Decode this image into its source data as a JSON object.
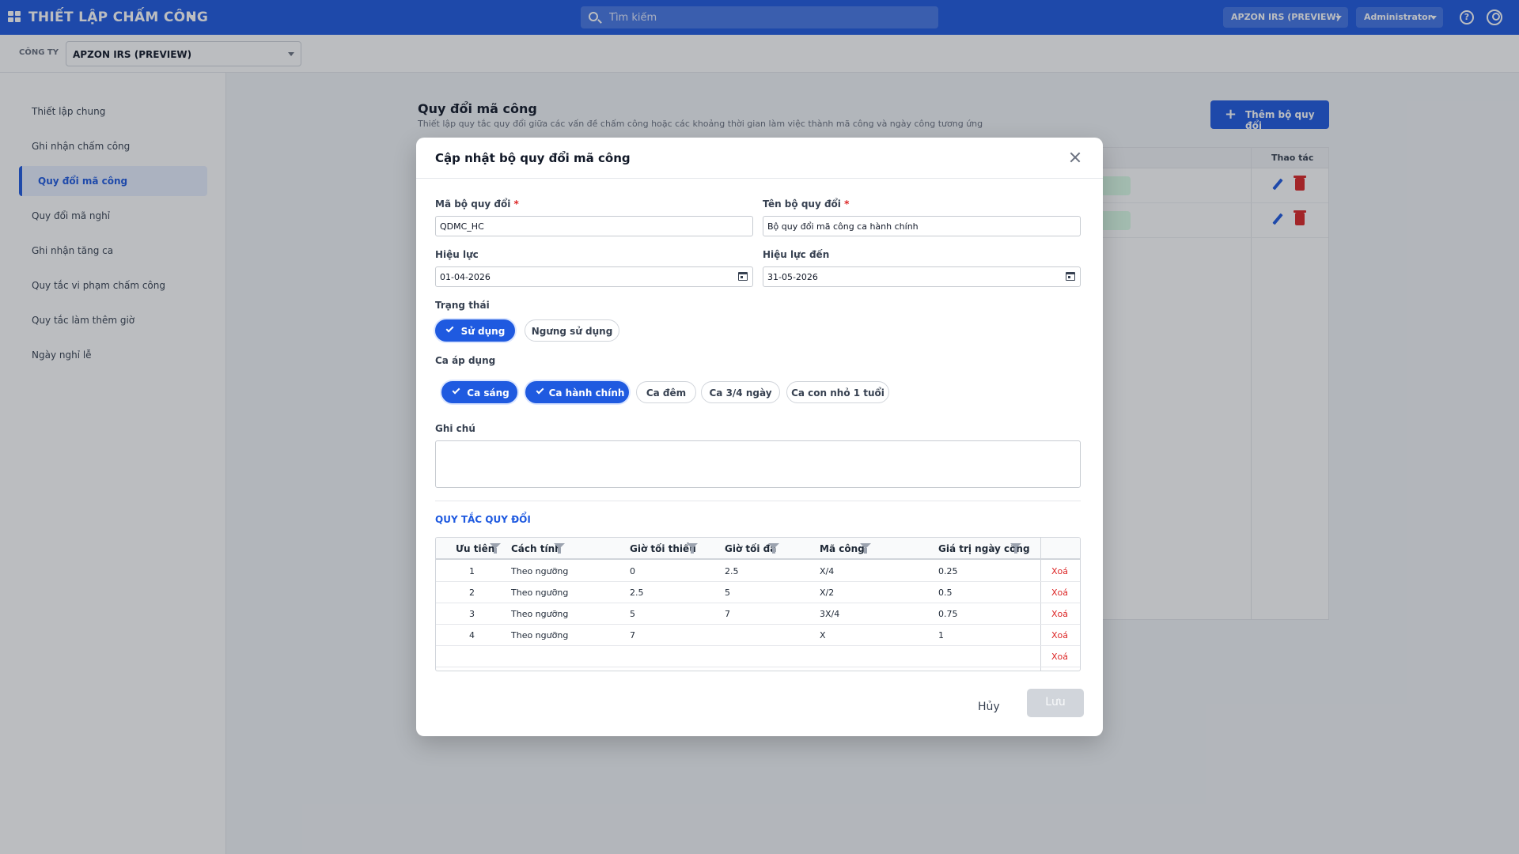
{
  "topbar": {
    "app_title": "THIẾT LẬP CHẤM CÔNG",
    "search_placeholder": "Tìm kiếm",
    "company_select": "APZON IRS (PREVIEW)",
    "role_select": "Administrator",
    "help_icon": "help-icon"
  },
  "company_bar": {
    "label": "CÔNG TY",
    "value": "APZON IRS (PREVIEW)"
  },
  "sidebar": {
    "items": [
      {
        "label": "Thiết lập chung"
      },
      {
        "label": "Ghi nhận chấm công"
      },
      {
        "label": "Quy đổi mã công",
        "active": true
      },
      {
        "label": "Quy đổi mã nghỉ"
      },
      {
        "label": "Ghi nhận tăng ca"
      },
      {
        "label": "Quy tắc vi phạm chấm công"
      },
      {
        "label": "Quy tắc làm thêm giờ"
      },
      {
        "label": "Ngày nghỉ lễ"
      }
    ]
  },
  "page": {
    "title": "Quy đổi mã công",
    "subtitle": "Thiết lập quy tắc quy đổi giữa các vấn đề chấm công hoặc các khoảng thời gian làm việc thành mã công và ngày công tương ứng",
    "add_button": "Thêm bộ quy đổi",
    "actions_header": "Thao tác"
  },
  "modal": {
    "title": "Cập nhật bộ quy đổi mã công",
    "code_label": "Mã bộ quy đổi",
    "code_value": "QDMC_HC",
    "name_label": "Tên bộ quy đổi",
    "name_value": "Bộ quy đổi mã công ca hành chính",
    "effective_label": "Hiệu lực",
    "effective_value": "01-04-2026",
    "effective_to_label": "Hiệu lực đến",
    "effective_to_value": "31-05-2026",
    "status_label": "Trạng thái",
    "status_options": [
      {
        "label": "Sử dụng",
        "selected": true
      },
      {
        "label": "Ngưng sử dụng",
        "selected": false
      }
    ],
    "shifts_label": "Ca áp dụng",
    "shifts": [
      {
        "label": "Ca sáng",
        "selected": true
      },
      {
        "label": "Ca hành chính",
        "selected": true
      },
      {
        "label": "Ca đêm",
        "selected": false
      },
      {
        "label": "Ca 3/4 ngày",
        "selected": false
      },
      {
        "label": "Ca con nhỏ 1 tuổi",
        "selected": false
      }
    ],
    "note_label": "Ghi chú",
    "note_value": "",
    "rules_title": "QUY TẮC QUY ĐỔI",
    "rules_headers": [
      "Ưu tiên",
      "Cách tính",
      "Giờ tối thiểu",
      "Giờ tối đa",
      "Mã công",
      "Giá trị ngày công"
    ],
    "rules_rows": [
      {
        "priority": "1",
        "method": "Theo ngưỡng",
        "min": "0",
        "max": "2.5",
        "code": "X/4",
        "value": "0.25",
        "delete": "Xoá"
      },
      {
        "priority": "2",
        "method": "Theo ngưỡng",
        "min": "2.5",
        "max": "5",
        "code": "X/2",
        "value": "0.5",
        "delete": "Xoá"
      },
      {
        "priority": "3",
        "method": "Theo ngưỡng",
        "min": "5",
        "max": "7",
        "code": "3X/4",
        "value": "0.75",
        "delete": "Xoá"
      },
      {
        "priority": "4",
        "method": "Theo ngưỡng",
        "min": "7",
        "max": "",
        "code": "X",
        "value": "1",
        "delete": "Xoá"
      },
      {
        "priority": "",
        "method": "",
        "min": "",
        "max": "",
        "code": "",
        "value": "",
        "delete": "Xoá"
      }
    ],
    "cancel_label": "Hủy",
    "save_label": "Lưu"
  },
  "colors": {
    "primary": "#1f5ae0",
    "danger": "#dc2626",
    "disabled": "#d1d5db"
  }
}
